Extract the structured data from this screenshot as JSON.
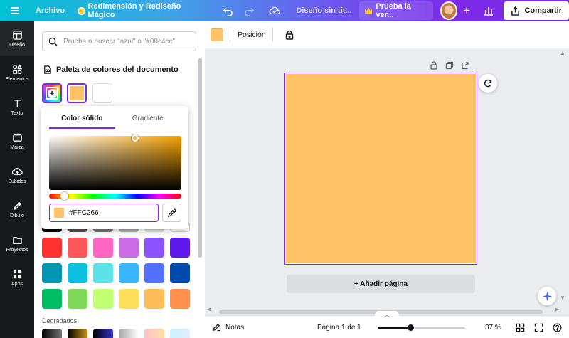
{
  "topbar": {
    "file_label": "Archivo",
    "magic_label": "Redimensión y Rediseño Mágico",
    "doc_title": "Diseño sin tit...",
    "trial_label": "Prueba la ver...",
    "share_label": "Compartir",
    "icons": [
      "menu-icon",
      "undo-icon",
      "redo-icon",
      "cloud-save-icon",
      "crown-icon",
      "plus-icon",
      "analytics-icon",
      "share-icon"
    ]
  },
  "rail": {
    "items": [
      {
        "label": "Diseño",
        "icon": "layout-icon"
      },
      {
        "label": "Elementos",
        "icon": "shapes-icon"
      },
      {
        "label": "Texto",
        "icon": "text-icon"
      },
      {
        "label": "Marca",
        "icon": "brand-icon"
      },
      {
        "label": "Subidos",
        "icon": "upload-icon"
      },
      {
        "label": "Dibujo",
        "icon": "draw-icon"
      },
      {
        "label": "Proyectos",
        "icon": "folder-icon"
      },
      {
        "label": "Apps",
        "icon": "apps-icon"
      }
    ]
  },
  "panel": {
    "search_placeholder": "Prueba a buscar \"azul\" o \"#00c4cc\"",
    "palette_title": "Paleta de colores del documento",
    "document_colors": [
      "#ffc266",
      "#ffffff"
    ],
    "gradients_label": "Degradados",
    "default_colors": [
      [
        "#000000",
        "#545454",
        "#737373",
        "#a6a6a6",
        "#d9d9d9",
        "#ffffff"
      ],
      [
        "#ff3131",
        "#ff5757",
        "#ff66c4",
        "#cb6ce6",
        "#8c52ff",
        "#5e17eb"
      ],
      [
        "#0097b2",
        "#0cc0df",
        "#5ce1e6",
        "#38b6ff",
        "#5271ff",
        "#004aad"
      ],
      [
        "#00bf63",
        "#7ed957",
        "#c1ff72",
        "#ffde59",
        "#ffbd59",
        "#ff914d"
      ]
    ]
  },
  "picker": {
    "tab_solid": "Color sólido",
    "tab_gradient": "Gradiente",
    "hex_value": "#FFC266",
    "base_hue": "#f59f00"
  },
  "canvas": {
    "position_label": "Posición",
    "fill_color": "#ffc266",
    "add_page_label": "+ Añadir página"
  },
  "bottom": {
    "notes_label": "Notas",
    "page_count": "Página 1 de 1",
    "zoom": "37 %",
    "zoom_fraction": 0.37
  },
  "colors": {
    "accent": "#7d2ae8",
    "rail_bg": "#18191b"
  }
}
